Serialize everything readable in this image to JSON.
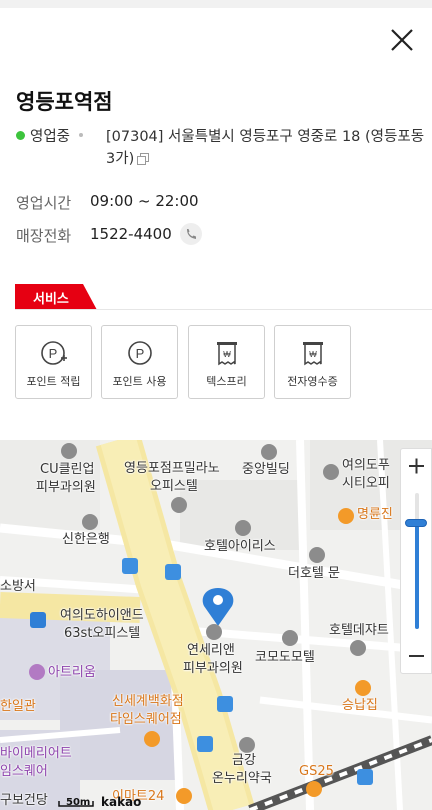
{
  "store": {
    "name": "영등포역점",
    "status": "영업중",
    "address": "[07304] 서울특별시 영등포구 영중로 18 (영등포동3가)"
  },
  "info": {
    "hours_label": "영업시간",
    "hours_value": "09:00 ~ 22:00",
    "phone_label": "매장전화",
    "phone_value": "1522-4400"
  },
  "services": {
    "tab_label": "서비스",
    "items": [
      {
        "label": "포인트 적립",
        "icon": "point-earn-icon"
      },
      {
        "label": "포인트 사용",
        "icon": "point-use-icon"
      },
      {
        "label": "텍스프리",
        "icon": "tax-free-icon"
      },
      {
        "label": "전자영수증",
        "icon": "e-receipt-icon"
      }
    ]
  },
  "colors": {
    "accent_red": "#e60012",
    "status_green": "#3dc43d",
    "map_pin_blue": "#2f7fd6"
  },
  "map": {
    "labels": {
      "cu_clinic_1": "CU클린업",
      "cu_clinic_2": "피부과의원",
      "officetel_1": "영등포점프밀라노",
      "officetel_2": "오피스텔",
      "jungang": "중앙빌딩",
      "yeouido_1": "여의도푸",
      "yeouido_2": "시티오피",
      "myeongryun": "명륜진",
      "shinhan": "신한은행",
      "hotel_iris": "호텔아이리스",
      "fire": "소방서",
      "hotel_moon": "더호텔 문",
      "hiand_1": "여의도하이앤드",
      "hiand_2": "63st오피스텔",
      "hotel_dejavu": "호텔데쟈트",
      "yonsei_1": "연세리앤",
      "yonsei_2": "피부과의원",
      "komodo": "코모도모텔",
      "atrium": "아트리움",
      "hanil": "한일관",
      "shinsegae_1": "신세계백화점",
      "shinsegae_2": "타임스퀘어점",
      "seungnap": "승납집",
      "buymerit_1": "바이메리어트",
      "buymerit_2": "임스퀘어",
      "geumgang_1": "금강",
      "geumgang_2": "온누리약국",
      "gs25": "GS25",
      "emart": "이마트24",
      "bottom_left": "구보건당"
    },
    "scale": "50m",
    "logo": "kakao",
    "zoom_level_fraction": 0.78
  }
}
